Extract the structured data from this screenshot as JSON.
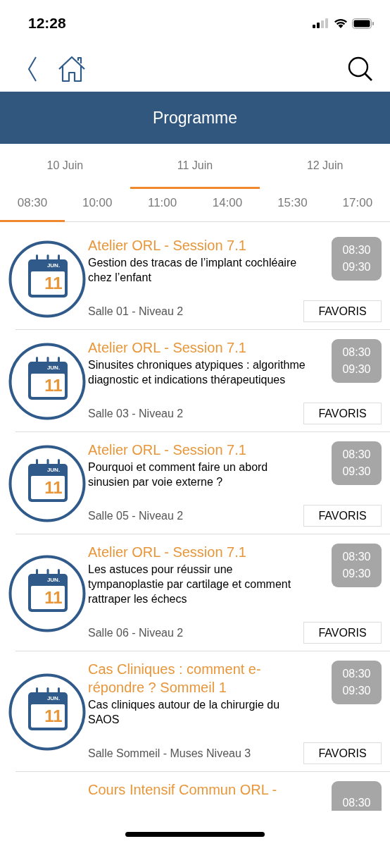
{
  "status_bar": {
    "time": "12:28"
  },
  "header": {
    "title": "Programme"
  },
  "days": [
    {
      "label": "10 Juin",
      "selected": false
    },
    {
      "label": "11 Juin",
      "selected": true
    },
    {
      "label": "12 Juin",
      "selected": false
    }
  ],
  "times": [
    {
      "label": "08:30",
      "selected": true
    },
    {
      "label": "10:00",
      "selected": false
    },
    {
      "label": "11:00",
      "selected": false
    },
    {
      "label": "14:00",
      "selected": false
    },
    {
      "label": "15:30",
      "selected": false
    },
    {
      "label": "17:00",
      "selected": false
    }
  ],
  "sessions": [
    {
      "badge_month": "JUN.",
      "badge_day": "11",
      "title": "Atelier ORL - Session 7.1",
      "description": "Gestion des tracas de l’implant cochléaire chez l’enfant",
      "location": "Salle 01 - Niveau 2",
      "start": "08:30",
      "end": "09:30",
      "button": "FAVORIS"
    },
    {
      "badge_month": "JUN.",
      "badge_day": "11",
      "title": "Atelier ORL - Session 7.1",
      "description": "Sinusites chroniques atypiques : algorithme diagnostic et indications thérapeutiques",
      "location": "Salle 03 - Niveau 2",
      "start": "08:30",
      "end": "09:30",
      "button": "FAVORIS"
    },
    {
      "badge_month": "JUN.",
      "badge_day": "11",
      "title": "Atelier ORL - Session 7.1",
      "description": "Pourquoi et comment faire un abord sinusien par voie externe ?",
      "location": "Salle 05 - Niveau 2",
      "start": "08:30",
      "end": "09:30",
      "button": "FAVORIS"
    },
    {
      "badge_month": "JUN.",
      "badge_day": "11",
      "title": "Atelier ORL - Session 7.1",
      "description": "Les astuces pour réussir une tympanoplastie par cartilage et comment rattraper les échecs",
      "location": "Salle 06 - Niveau 2",
      "start": "08:30",
      "end": "09:30",
      "button": "FAVORIS"
    },
    {
      "badge_month": "JUN.",
      "badge_day": "11",
      "title": "Cas Cliniques : comment e-répondre ? Sommeil 1",
      "description": "Cas cliniques  autour de la chirurgie du SAOS",
      "location": "Salle Sommeil - Muses Niveau 3",
      "start": "08:30",
      "end": "09:30",
      "button": "FAVORIS"
    }
  ],
  "partial_session": {
    "title": "Cours Intensif Commun ORL -",
    "start": "08:30"
  }
}
